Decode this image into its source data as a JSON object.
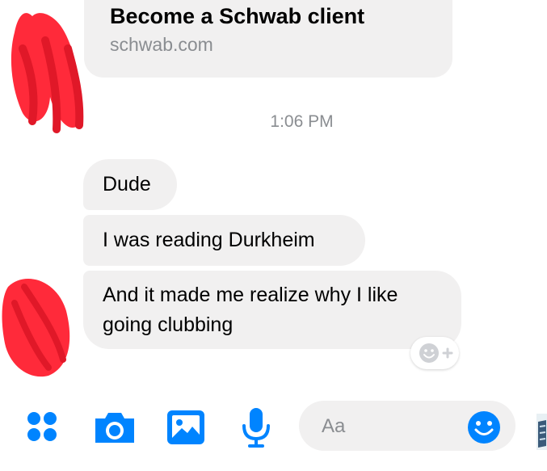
{
  "link_preview": {
    "title": "Become a Schwab client",
    "domain": "schwab.com"
  },
  "timestamp": "1:06 PM",
  "messages": [
    {
      "text": "Dude"
    },
    {
      "text": "I was reading Durkheim"
    },
    {
      "line1": "And it made me realize why I like",
      "line2": "going clubbing"
    }
  ],
  "composer": {
    "placeholder": "Aa",
    "icons": [
      "apps-grid-icon",
      "camera-icon",
      "gallery-icon",
      "microphone-icon",
      "smiley-icon"
    ]
  },
  "colors": {
    "accent": "#0084ff",
    "bubble": "#f1f0f0",
    "muted_text": "#8a8d91",
    "redaction": "#ff2a3a"
  }
}
